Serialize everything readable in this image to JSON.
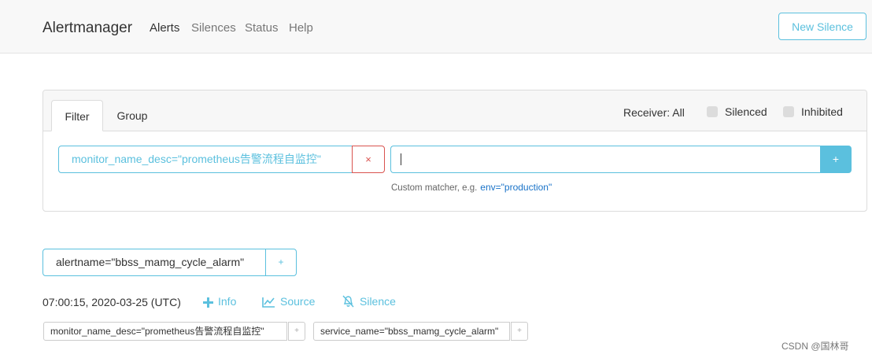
{
  "nav": {
    "brand": "Alertmanager",
    "links": [
      "Alerts",
      "Silences",
      "Status",
      "Help"
    ],
    "new_silence": "New Silence"
  },
  "filter_panel": {
    "tabs": [
      "Filter",
      "Group"
    ],
    "receiver": "Receiver: All",
    "silenced": "Silenced",
    "inhibited": "Inhibited",
    "active_filter": "monitor_name_desc=\"prometheus告警流程自监控\"",
    "remove_glyph": "×",
    "add_glyph": "+",
    "hint": "Custom matcher, e.g.",
    "hint_example": "env=\"production\""
  },
  "group": {
    "matcher": "alertname=\"bbss_mamg_cycle_alarm\"",
    "add_glyph": "+",
    "alert": {
      "timestamp": "07:00:15, 2020-03-25 (UTC)",
      "actions": {
        "info": "Info",
        "source": "Source",
        "silence": "Silence"
      },
      "labels": [
        "monitor_name_desc=\"prometheus告警流程自监控\"",
        "service_name=\"bbss_mamg_cycle_alarm\""
      ],
      "label_add_glyph": "+"
    }
  },
  "watermark": "CSDN @国林哥",
  "colors": {
    "accent": "#5bc0de",
    "danger": "#d9534f",
    "link": "#1a73c8"
  }
}
